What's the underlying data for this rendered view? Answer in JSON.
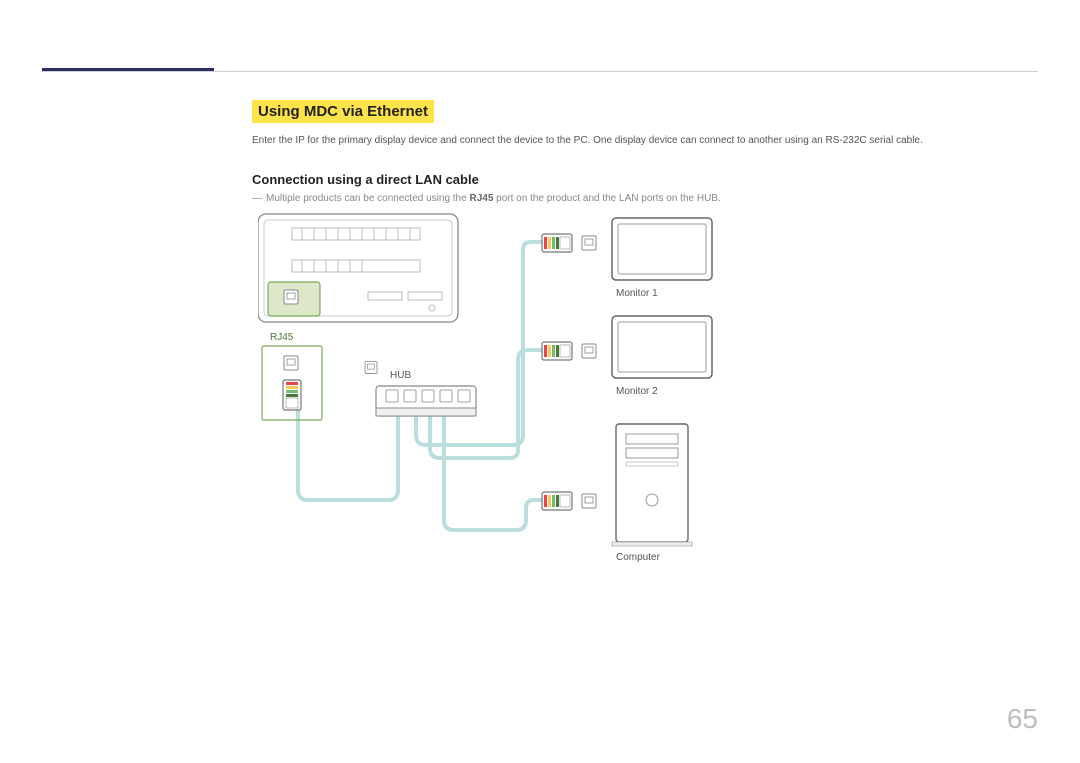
{
  "page_number": "65",
  "section_title": "Using MDC via Ethernet",
  "intro_text": "Enter the IP for the primary display device and connect the device to the PC. One display device can connect to another using an RS-232C serial cable.",
  "subheading": "Connection using a direct LAN cable",
  "note_prefix": "―",
  "note_before_bold": "Multiple products can be connected using the ",
  "note_bold": "RJ45",
  "note_after_bold": " port on the product and the LAN ports on the HUB.",
  "labels": {
    "rj45": "RJ45",
    "hub": "HUB",
    "monitor1": "Monitor 1",
    "monitor2": "Monitor 2",
    "computer": "Computer"
  }
}
